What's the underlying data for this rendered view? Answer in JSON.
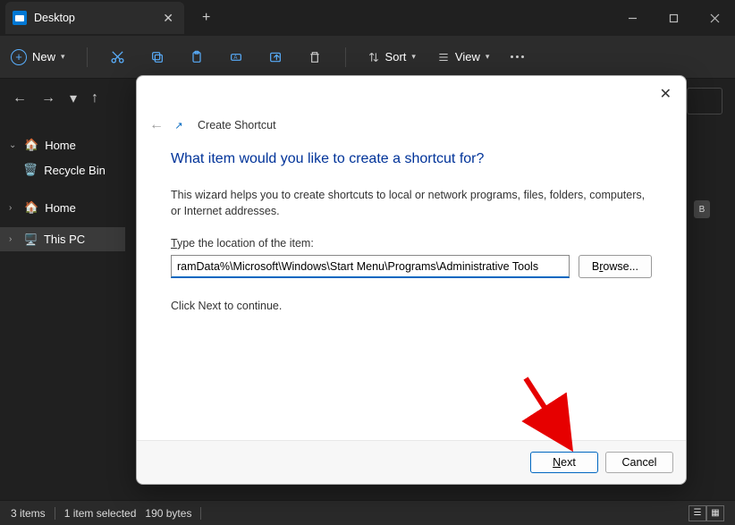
{
  "titlebar": {
    "tab_title": "Desktop"
  },
  "toolbar": {
    "new_label": "New",
    "sort_label": "Sort",
    "view_label": "View"
  },
  "sidebar": {
    "home": "Home",
    "recycle_bin": "Recycle Bin",
    "home2": "Home",
    "this_pc": "This PC"
  },
  "badge_right": "B",
  "statusbar": {
    "count": "3 items",
    "selection": "1 item selected",
    "size": "190 bytes"
  },
  "dialog": {
    "nav_title": "Create Shortcut",
    "heading": "What item would you like to create a shortcut for?",
    "description": "This wizard helps you to create shortcuts to local or network programs, files, folders, computers, or Internet addresses.",
    "field_label_pre": "T",
    "field_label_rest": "ype the location of the item:",
    "location_value": "ramData%\\Microsoft\\Windows\\Start Menu\\Programs\\Administrative Tools",
    "browse_label": "Browse...",
    "browse_key": "r",
    "continue_text": "Click Next to continue.",
    "next_label": "Next",
    "next_key": "N",
    "cancel_label": "Cancel"
  }
}
